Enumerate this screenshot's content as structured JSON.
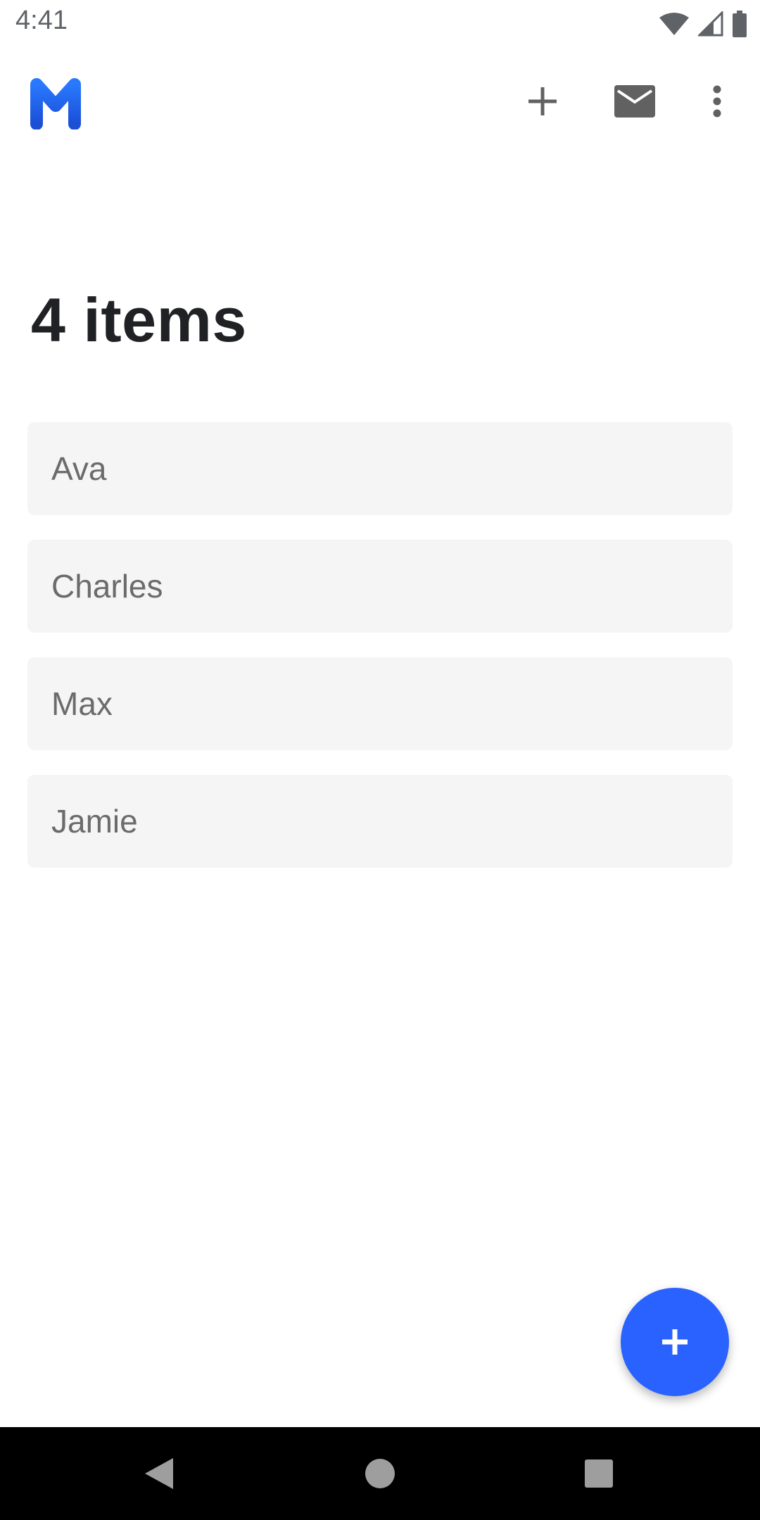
{
  "status_bar": {
    "time": "4:41",
    "icons": [
      "wifi-icon",
      "signal-icon",
      "battery-icon"
    ]
  },
  "toolbar": {
    "logo": "m-logo",
    "actions": [
      "add-icon",
      "mail-icon",
      "more-vert-icon"
    ]
  },
  "main": {
    "title": "4 items",
    "items": [
      {
        "label": "Ava"
      },
      {
        "label": "Charles"
      },
      {
        "label": "Max"
      },
      {
        "label": "Jamie"
      }
    ]
  },
  "fab": {
    "icon": "add-icon"
  },
  "nav": {
    "buttons": [
      "back-icon",
      "home-icon",
      "recents-icon"
    ]
  },
  "colors": {
    "accent": "#2962ff",
    "logo_top": "#2979ff",
    "logo_bottom": "#1a4fd6",
    "item_background": "#f5f5f5",
    "icon_gray": "#616161"
  }
}
